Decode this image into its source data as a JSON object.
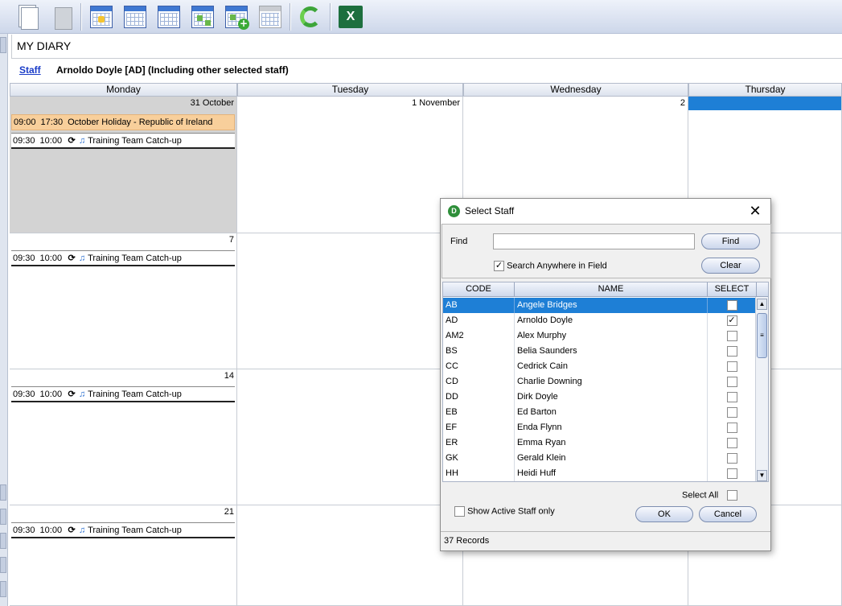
{
  "toolbar": {
    "buttons": [
      "new-document-icon",
      "paste-document-icon",
      "day-view-icon",
      "week-view-icon",
      "work-week-view-icon",
      "month-view-icon",
      "add-calendar-icon",
      "blank-calendar-icon",
      "refresh-icon",
      "excel-export-icon"
    ],
    "excel_letter": "X"
  },
  "page": {
    "title": "MY DIARY",
    "staff_link": "Staff",
    "staff_desc": "Arnoldo Doyle [AD]  (Including other selected staff)"
  },
  "calendar": {
    "days": [
      "Monday",
      "Tuesday",
      "Wednesday",
      "Thursday"
    ],
    "weeks": [
      {
        "dates": [
          "31 October",
          "1 November",
          "2",
          ""
        ],
        "events": [
          {
            "start": "09:00",
            "end": "17:30",
            "title": "October Holiday - Republic of Ireland",
            "type": "holiday"
          },
          {
            "start": "09:30",
            "end": "10:00",
            "title": "Training Team Catch-up",
            "type": "meeting"
          }
        ]
      },
      {
        "dates": [
          "7",
          "",
          "",
          ""
        ],
        "events": [
          {
            "start": "09:30",
            "end": "10:00",
            "title": "Training Team Catch-up",
            "type": "meeting"
          }
        ]
      },
      {
        "dates": [
          "14",
          "",
          "",
          ""
        ],
        "events": [
          {
            "start": "09:30",
            "end": "10:00",
            "title": "Training Team Catch-up",
            "type": "meeting"
          }
        ]
      },
      {
        "dates": [
          "21",
          "",
          "",
          ""
        ],
        "events": [
          {
            "start": "09:30",
            "end": "10:00",
            "title": "Training Team Catch-up",
            "type": "meeting"
          }
        ]
      }
    ]
  },
  "dialog": {
    "title": "Select Staff",
    "close": "✕",
    "find_label": "Find",
    "find_value": "",
    "find_button": "Find",
    "clear_button": "Clear",
    "search_anywhere_label": "Search Anywhere in Field",
    "search_anywhere_checked": true,
    "columns": [
      "CODE",
      "NAME",
      "SELECT"
    ],
    "rows": [
      {
        "code": "AB",
        "name": "Angele Bridges",
        "selected": false,
        "highlighted": true
      },
      {
        "code": "AD",
        "name": "Arnoldo Doyle",
        "selected": true,
        "highlighted": false
      },
      {
        "code": "AM2",
        "name": "Alex Murphy",
        "selected": false,
        "highlighted": false
      },
      {
        "code": "BS",
        "name": "Belia Saunders",
        "selected": false,
        "highlighted": false
      },
      {
        "code": "CC",
        "name": "Cedrick Cain",
        "selected": false,
        "highlighted": false
      },
      {
        "code": "CD",
        "name": "Charlie Downing",
        "selected": false,
        "highlighted": false
      },
      {
        "code": "DD",
        "name": "Dirk Doyle",
        "selected": false,
        "highlighted": false
      },
      {
        "code": "EB",
        "name": "Ed Barton",
        "selected": false,
        "highlighted": false
      },
      {
        "code": "EF",
        "name": "Enda Flynn",
        "selected": false,
        "highlighted": false
      },
      {
        "code": "ER",
        "name": "Emma Ryan",
        "selected": false,
        "highlighted": false
      },
      {
        "code": "GK",
        "name": "Gerald Klein",
        "selected": false,
        "highlighted": false
      },
      {
        "code": "HH",
        "name": "Heidi Huff",
        "selected": false,
        "highlighted": false
      }
    ],
    "select_all_label": "Select All",
    "select_all_checked": false,
    "active_only_label": "Show Active Staff only",
    "active_only_checked": false,
    "ok_button": "OK",
    "cancel_button": "Cancel",
    "status": "37 Records"
  },
  "colors": {
    "holiday": "#f8cf9b",
    "selection": "#1e7fd6",
    "link": "#1a3cc8"
  }
}
